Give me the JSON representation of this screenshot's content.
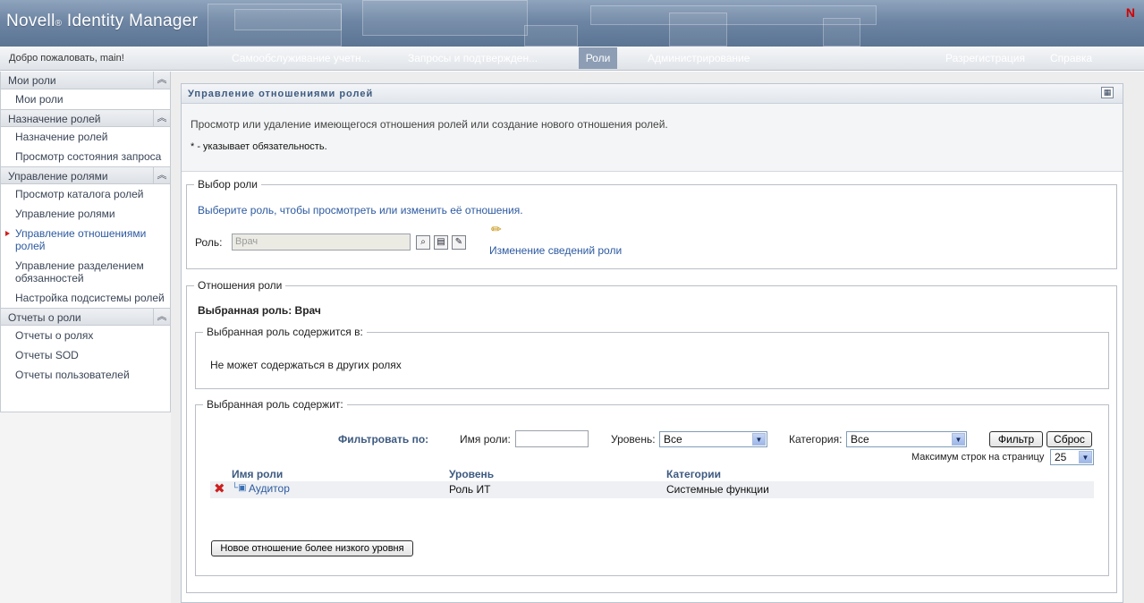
{
  "header": {
    "brand_a": "Novell",
    "brand_reg": "®",
    "brand_b": "Identity Manager",
    "logo": "N"
  },
  "navbar": {
    "welcome": "Добро пожаловать, main!",
    "tabs": [
      "Самообслуживание учетн...",
      "Запросы и подтвержден...",
      "Роли",
      "Администрирование"
    ],
    "logout": "Разрегистрация",
    "help": "Справка"
  },
  "sidebar": {
    "sections": [
      {
        "title": "Мои роли",
        "items": [
          "Мои роли"
        ]
      },
      {
        "title": "Назначение ролей",
        "items": [
          "Назначение ролей",
          "Просмотр состояния запроса"
        ]
      },
      {
        "title": "Управление ролями",
        "items": [
          "Просмотр каталога ролей",
          "Управление ролями",
          "Управление отношениями ролей",
          "Управление разделением обязанностей",
          "Настройка подсистемы ролей"
        ]
      },
      {
        "title": "Отчеты о роли",
        "items": [
          "Отчеты о ролях",
          "Отчеты SOD",
          "Отчеты пользователей"
        ]
      }
    ]
  },
  "portlet": {
    "title": "Управление отношениями ролей",
    "description": "Просмотр или удаление имеющегося отношения ролей или создание нового отношения ролей.",
    "required_note": "* - указывает обязательность."
  },
  "role_select": {
    "legend": "Выбор роли",
    "hint": "Выберите роль, чтобы просмотреть или изменить её отношения.",
    "role_label": "Роль:",
    "role_value": "Врач",
    "edit_link": "Изменение сведений роли"
  },
  "relations": {
    "legend": "Отношения роли",
    "selected": "Выбранная роль: Врач",
    "contained_in_legend": "Выбранная роль содержится в:",
    "contained_in_text": "Не может содержаться в других ролях",
    "contains_legend": "Выбранная роль содержит:",
    "filter_by": "Фильтровать по:",
    "role_name_label": "Имя роли:",
    "level_label": "Уровень:",
    "level_value": "Все",
    "category_label": "Категория:",
    "category_value": "Все",
    "filter_btn": "Фильтр",
    "reset_btn": "Сброс",
    "max_rows_label": "Максимум строк на страницу",
    "max_rows_value": "25",
    "columns": [
      "Имя роли",
      "Уровень",
      "Категории"
    ],
    "rows": [
      {
        "name": "Аудитор",
        "level": "Роль ИТ",
        "category": "Системные функции"
      }
    ],
    "new_lower_btn": "Новое отношение более низкого уровня"
  },
  "colors": {
    "accent": "#2d5aa0",
    "header_title": "#3d5a80",
    "delete": "#cc1f1f"
  }
}
